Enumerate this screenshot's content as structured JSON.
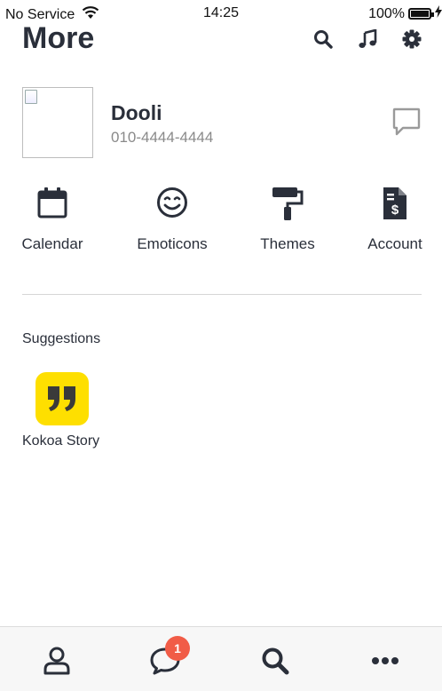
{
  "status_bar": {
    "carrier": "No Service",
    "time": "14:25",
    "battery": "100%"
  },
  "header": {
    "title": "More",
    "actions": [
      "search-icon",
      "music-icon",
      "gear-icon"
    ]
  },
  "profile": {
    "name": "Dooli",
    "phone": "010-4444-4444"
  },
  "quick_menu": [
    {
      "label": "Calendar",
      "icon": "calendar-icon"
    },
    {
      "label": "Emoticons",
      "icon": "smile-icon"
    },
    {
      "label": "Themes",
      "icon": "paint-roller-icon"
    },
    {
      "label": "Account",
      "icon": "invoice-dollar-icon"
    }
  ],
  "suggestions": {
    "title": "Suggestions",
    "items": [
      {
        "label": "Kokoa Story",
        "icon": "quote-icon",
        "color": "#fedf00"
      }
    ]
  },
  "bottom_nav": {
    "items": [
      "person-icon",
      "chat-bubble-icon",
      "search-icon",
      "more-dots-icon"
    ],
    "chat_badge": "1",
    "badge_color": "#f15c47"
  }
}
